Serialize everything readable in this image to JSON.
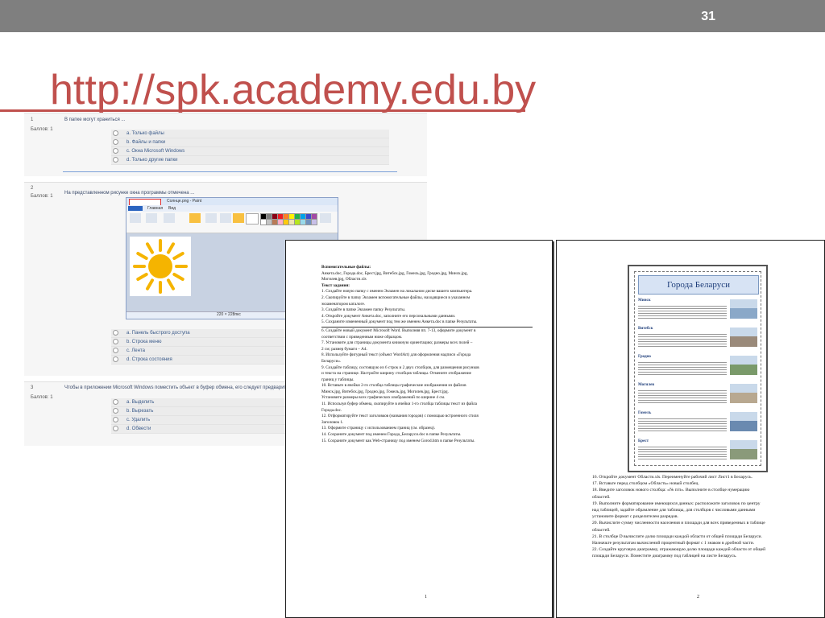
{
  "slide": {
    "number": "31",
    "title": "http://spk.academy.edu.by"
  },
  "quiz": {
    "score_label": "Баллов: 1",
    "questions": [
      {
        "number": "1",
        "text": "В папке могут храниться ...",
        "options": [
          "a. Только файлы",
          "b. Файлы и папки",
          "c. Окна Microsoft Windows",
          "d. Только другие папки"
        ]
      },
      {
        "number": "2",
        "text": "На представленном рисунке окна программы отмечена ...",
        "options": [
          "a. Панель быстрого доступа",
          "b. Строка меню",
          "c. Лента",
          "d. Строка состояния"
        ]
      },
      {
        "number": "3",
        "text": "Чтобы в приложении Microsoft Windows поместить объект в буфер обмена, его следует предварительно ...",
        "options": [
          "a. Выделить",
          "b. Вырезать",
          "c. Удалить",
          "d. Обвести"
        ]
      }
    ]
  },
  "paint": {
    "title": "Солнце.png - Paint",
    "tab_home": "Главная",
    "tab_view": "Вид",
    "status": "220 × 228пкс",
    "sun_color": "#f5b400",
    "swatches": [
      "#000000",
      "#7f7f7f",
      "#880015",
      "#ed1c24",
      "#ff7f27",
      "#fff200",
      "#22b14c",
      "#00a2e8",
      "#3f48cc",
      "#a349a4",
      "#ffffff",
      "#c3c3c3",
      "#b97a57",
      "#ffaec9",
      "#ffc90e",
      "#efe4b0",
      "#b5e61d",
      "#99d9ea",
      "#7092be",
      "#c8bfe7"
    ]
  },
  "doc1": {
    "page_number": "1",
    "lines": [
      {
        "t": "Вспомогательные файлы:",
        "b": true
      },
      {
        "t": "Анкета.doc, Города.doc, Брест.jpg, Витебск.jpg, Гомель.jpg, Гродно.jpg, Минск.jpg,"
      },
      {
        "t": "Могилев.jpg, Области.xls"
      },
      {
        "t": "Текст задания:",
        "b": true
      },
      {
        "t": "1.  Создайте новую папку с именем Экзамен на локальном диске вашего компьютера."
      },
      {
        "t": "2.  Скопируйте в папку Экзамен вспомогательные файлы, находящиеся в указанном"
      },
      {
        "t": "     экзаменатором каталоге."
      },
      {
        "t": "3.  Создайте в папке Экзамен папку Результаты."
      },
      {
        "t": "4.  Откройте документ Анкета.doc, заполните его персональными данными."
      },
      {
        "t": "5.  Сохраните измененный документ под тем же именем Анкета.doc в папке Результаты.",
        "rule": true
      },
      {
        "t": "6.  Создайте новый документ Microsoft Word. Выполняя пп. 7-13, оформите документ в"
      },
      {
        "t": "     соответствии с приведенным ниже образцом."
      },
      {
        "t": "7.  Установите для страницы документа книжную ориентацию; размеры всех полей –"
      },
      {
        "t": "     2 см; размер бумаги – А4."
      },
      {
        "t": "8.  Используйте фигурный текст (объект WordArt) для оформления надписи «Города"
      },
      {
        "t": "     Беларуси»."
      },
      {
        "t": "9.  Создайте таблицу, состоящую из 6 строк и 2 двух столбцов, для размещения рисунков"
      },
      {
        "t": "     и текста на странице. Настройте ширину столбцов таблицы. Отмените отображение"
      },
      {
        "t": "     границ у таблицы."
      },
      {
        "t": "10. Вставьте в ячейки 2-го столбца таблицы графические изображения из файлов"
      },
      {
        "t": "     Минск.jpg, Витебск.jpg, Гродно.jpg, Гомель.jpg, Могилев.jpg, Брест.jpg."
      },
      {
        "t": "     Установите размеры всех графических изображений по ширине 4 см."
      },
      {
        "t": "11. Используя буфер обмена, скопируйте в ячейки 1-го столбца таблицы текст из файла"
      },
      {
        "t": "     Города.doc."
      },
      {
        "t": "12. Отформатируйте текст заголовков (названия городов) с помощью встроенного стиля"
      },
      {
        "t": "     Заголовок 1."
      },
      {
        "t": "13. Оформите страницу с использованием границ (см. образец)."
      },
      {
        "t": "14. Сохраните документ под именем Города_Беларуси.doc в папке Результаты."
      },
      {
        "t": "15. Сохраните документ как Web-страницу под именем Gorod.htm в папке Результаты."
      }
    ]
  },
  "doc2": {
    "page_number": "2",
    "poster_title": "Города Беларуси",
    "cities": [
      "Минск",
      "Витебск",
      "Гродно",
      "Могилев",
      "Гомель",
      "Брест"
    ],
    "lines": [
      "16. Откройте документ Области.xls. Переименуйте рабочий лист Лист1 в Беларусь.",
      "17. Вставьте перед столбцом «Область» новый столбец.",
      "18. Введите заголовок нового столбца: «№ п/п». Выполните в столбце нумерацию",
      "      областей.",
      "19. Выполните форматирование имеющихся данных: расположите заголовок по центру",
      "      над таблицей, задайте обрамление для таблицы, для столбцов с числовыми данными",
      "      установите формат с разделителем разрядов.",
      "20. Вычислите сумму численности населения и площади для всех приведенных в таблице",
      "      областей.",
      "21. В столбце D вычислите долю площади каждой области от общей площади Беларуси.",
      "      Назначьте результатам вычислений процентный формат с 1 знаком в дробной части.",
      "22. Создайте круговую диаграмму, отражающую долю площади каждой области от общей",
      "      площади Беларуси. Поместите диаграмму под таблицей на листе Беларусь."
    ]
  }
}
